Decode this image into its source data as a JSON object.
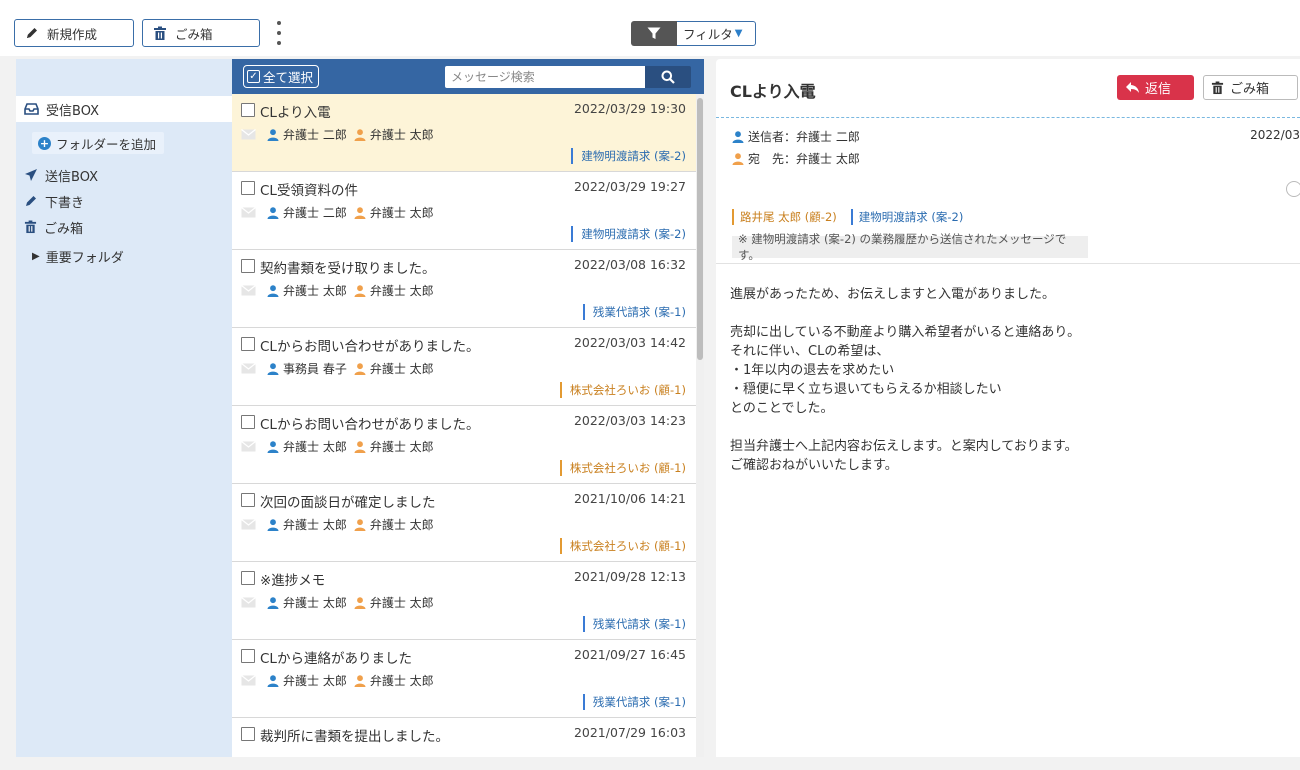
{
  "toolbar": {
    "new_label": "新規作成",
    "trash_label": "ごみ箱",
    "filter_label": "フィルタ"
  },
  "sidebar": {
    "inbox": "受信BOX",
    "add_folder": "フォルダーを追加",
    "sent": "送信BOX",
    "drafts": "下書き",
    "trash": "ごみ箱",
    "important_folder": "重要フォルダ"
  },
  "list": {
    "select_all": "全て選択",
    "search_placeholder": "メッセージ検索",
    "messages": [
      {
        "subject": "CLより入電",
        "date": "2022/03/29 19:30",
        "from": "弁護士 二郎",
        "to": "弁護士 太郎",
        "tag": "建物明渡請求 (案-2)",
        "tag_color": "blue"
      },
      {
        "subject": "CL受領資料の件",
        "date": "2022/03/29 19:27",
        "from": "弁護士 二郎",
        "to": "弁護士 太郎",
        "tag": "建物明渡請求 (案-2)",
        "tag_color": "blue"
      },
      {
        "subject": "契約書類を受け取りました。",
        "date": "2022/03/08 16:32",
        "from": "弁護士 太郎",
        "to": "弁護士 太郎",
        "tag": "残業代請求 (案-1)",
        "tag_color": "blue"
      },
      {
        "subject": "CLからお問い合わせがありました。",
        "date": "2022/03/03 14:42",
        "from": "事務員 春子",
        "to": "弁護士 太郎",
        "tag": "株式会社ろいお (顧-1)",
        "tag_color": "orange"
      },
      {
        "subject": "CLからお問い合わせがありました。",
        "date": "2022/03/03 14:23",
        "from": "弁護士 太郎",
        "to": "弁護士 太郎",
        "tag": "株式会社ろいお (顧-1)",
        "tag_color": "orange"
      },
      {
        "subject": "次回の面談日が確定しました",
        "date": "2021/10/06 14:21",
        "from": "弁護士 太郎",
        "to": "弁護士 太郎",
        "tag": "株式会社ろいお (顧-1)",
        "tag_color": "orange"
      },
      {
        "subject": "※進捗メモ",
        "date": "2021/09/28 12:13",
        "from": "弁護士 太郎",
        "to": "弁護士 太郎",
        "tag": "残業代請求 (案-1)",
        "tag_color": "blue"
      },
      {
        "subject": "CLから連絡がありました",
        "date": "2021/09/27 16:45",
        "from": "弁護士 太郎",
        "to": "弁護士 太郎",
        "tag": "残業代請求 (案-1)",
        "tag_color": "blue"
      },
      {
        "subject": "裁判所に書類を提出しました。",
        "date": "2021/07/29 16:03",
        "from": "",
        "to": "",
        "tag": "",
        "tag_color": "blue"
      }
    ]
  },
  "detail": {
    "title": "CLより入電",
    "reply_label": "返信",
    "trash_label": "ごみ箱",
    "sender_label": "送信者：",
    "sender_name": "弁護士 二郎",
    "recipient_label": "宛　先：",
    "recipient_name": "弁護士 太郎",
    "date": "2022/03",
    "tags": [
      {
        "label": "路井尾 太郎 (顧-2)",
        "color": "orange"
      },
      {
        "label": "建物明渡請求 (案-2)",
        "color": "blue"
      }
    ],
    "notice": "※ 建物明渡請求 (案-2) の業務履歴から送信されたメッセージです。",
    "body_lines": [
      "進展があったため、お伝えしますと入電がありました。",
      "",
      "売却に出している不動産より購入希望者がいると連絡あり。",
      "それに伴い、CLの希望は、",
      "・1年以内の退去を求めたい",
      "・穏便に早く立ち退いてもらえるか相談したい",
      "とのことでした。",
      "",
      "担当弁護士へ上記内容お伝えします。と案内しております。",
      "ご確認おねがいいたします。"
    ]
  },
  "colors": {
    "accent_blue": "#3566a3",
    "reply_red": "#d9334a",
    "person_blue": "#2c82c9",
    "person_orange": "#f0a04b",
    "selected_bg": "#fdf4d8"
  }
}
